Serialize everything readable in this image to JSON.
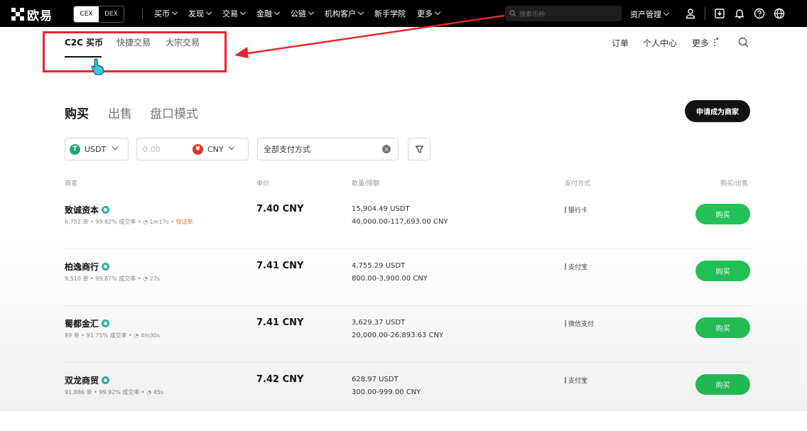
{
  "topbar": {
    "logo_text": "欧易",
    "cex": "CEX",
    "dex": "DEX",
    "nav": [
      "买币",
      "发现",
      "交易",
      "金融",
      "公链",
      "机构客户",
      "新手学院",
      "更多"
    ],
    "nav_has_caret": [
      true,
      true,
      true,
      true,
      true,
      true,
      false,
      true
    ],
    "search_placeholder": "搜索币种",
    "asset_mgmt": "资产管理",
    "icons": [
      "user-icon",
      "download-icon",
      "bell-icon",
      "help-icon",
      "globe-icon"
    ]
  },
  "subnav": {
    "items": [
      "C2C 买币",
      "快捷交易",
      "大宗交易"
    ],
    "active_index": 0,
    "right": [
      "订单",
      "个人中心",
      "更多"
    ]
  },
  "trade": {
    "tabs": [
      "购买",
      "出售",
      "盘口模式"
    ],
    "active_index": 0,
    "merchant_button": "申请成为商家"
  },
  "filters": {
    "coin": "USDT",
    "amount_placeholder": "0.00",
    "fiat": "CNY",
    "payment": "全部支付方式"
  },
  "table": {
    "headers": [
      "商家",
      "单价",
      "数量/限额",
      "支付方式",
      "购买/出售"
    ],
    "rows": [
      {
        "merchant": "致诚资本",
        "stats": "6,752 单 • 99.82% 成交率 • ",
        "time": "1m17s",
        "extra": "保证单",
        "price": "7.40 CNY",
        "quantity": "15,904.49 USDT",
        "limit": "40,000.00-117,693.00 CNY",
        "payment": "银行卡",
        "button": "购买"
      },
      {
        "merchant": "柏逸商行",
        "stats": "9,510 单 • 99.87% 成交率 • ",
        "time": "27s",
        "extra": "",
        "price": "7.41 CNY",
        "quantity": "4,755.29 USDT",
        "limit": "800.00-3,900.00 CNY",
        "payment": "支付宝",
        "button": "购买"
      },
      {
        "merchant": "蜀都金汇",
        "stats": "89 单 • 91.75% 成交率 • ",
        "time": "4m30s",
        "extra": "",
        "price": "7.41 CNY",
        "quantity": "3,629.37 USDT",
        "limit": "20,000.00-26,893.63 CNY",
        "payment": "微信支付",
        "button": "购买"
      },
      {
        "merchant": "双龙商贸",
        "stats": "91,886 单 • 99.92% 成交率 • ",
        "time": "45s",
        "extra": "",
        "price": "7.42 CNY",
        "quantity": "628.97 USDT",
        "limit": "300.00-999.00 CNY",
        "payment": "支付宝",
        "button": "购买"
      }
    ]
  },
  "colors": {
    "buy_green": "#23c157",
    "highlight_red": "#e8262a",
    "usdt_teal": "#26a17b",
    "cny_red": "#d33a2c"
  }
}
